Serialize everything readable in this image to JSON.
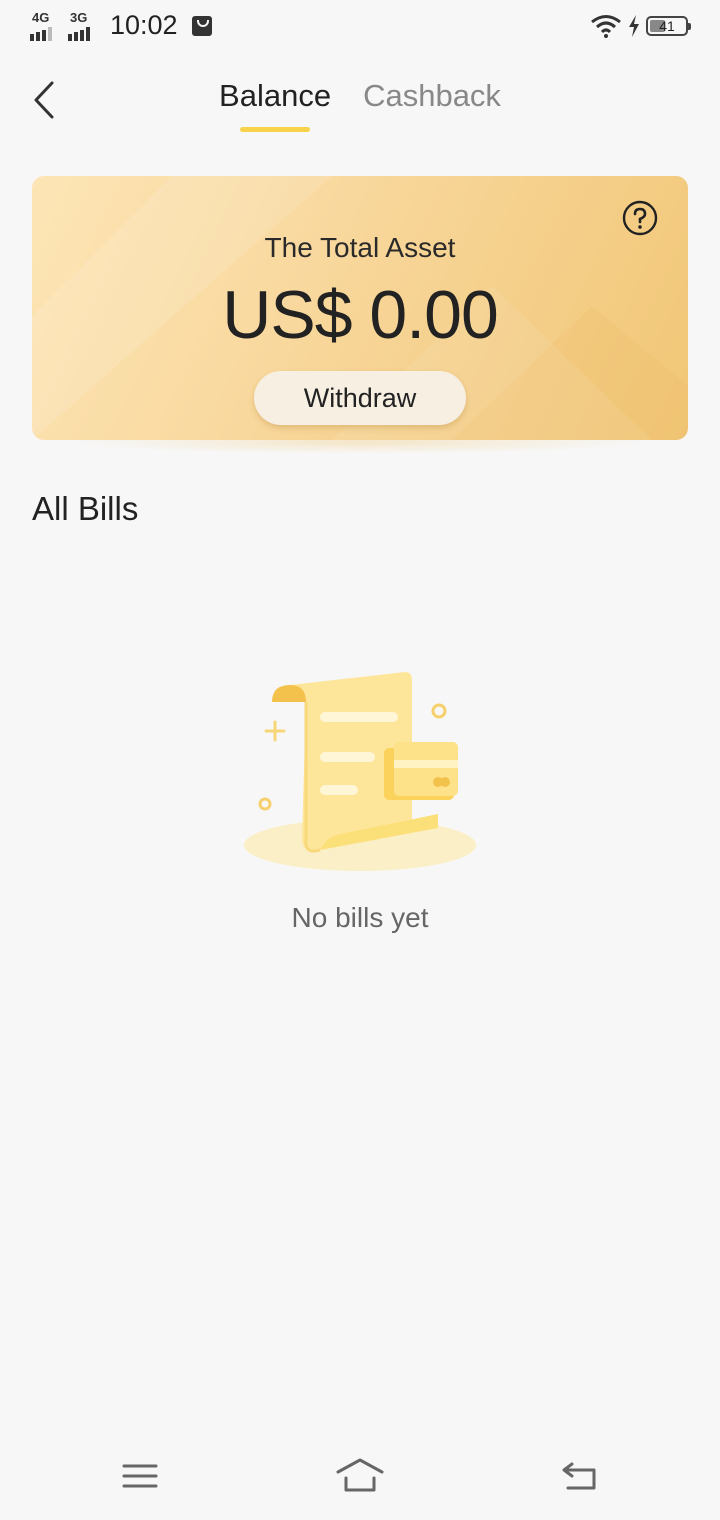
{
  "status_bar": {
    "network_1": "4G",
    "network_2": "3G",
    "time": "10:02",
    "battery_level": "41"
  },
  "header": {
    "tabs": [
      {
        "label": "Balance",
        "active": true
      },
      {
        "label": "Cashback",
        "active": false
      }
    ]
  },
  "asset_card": {
    "title": "The Total Asset",
    "amount": "US$ 0.00",
    "withdraw_label": "Withdraw"
  },
  "bills": {
    "title": "All Bills",
    "empty_text": "No bills yet"
  },
  "colors": {
    "accent": "#f7d24a",
    "card_start": "#fde5b6",
    "card_end": "#f1c676"
  },
  "icons": {
    "back": "chevron-left-icon",
    "help": "question-circle-icon",
    "nav_menu": "menu-icon",
    "nav_home": "home-icon",
    "nav_back": "back-arrow-icon"
  }
}
